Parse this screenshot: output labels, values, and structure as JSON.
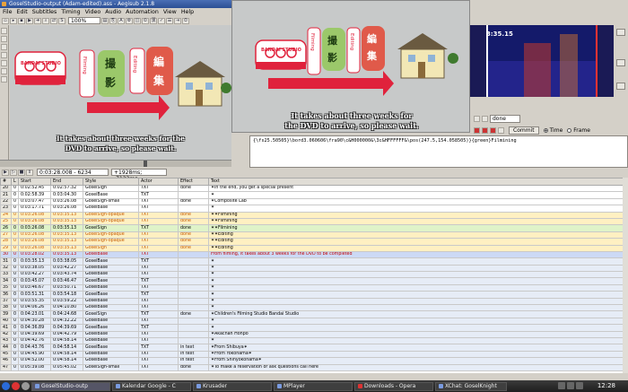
{
  "window_title": "GoselStudio-output (Adam-edited).ass - Aegisub 2.1.8",
  "menu": [
    "File",
    "Edit",
    "Subtitles",
    "Timing",
    "Video",
    "Audio",
    "Automation",
    "View",
    "Help"
  ],
  "zoom": "100%",
  "scene": {
    "studio_name": "BANDAI STUDIO",
    "film_label": "Filming",
    "film_kanji": [
      "撮",
      "影"
    ],
    "edit_label": "Editing",
    "edit_kanji": [
      "編",
      "集"
    ],
    "subtitle_line1": "It takes about three weeks for the",
    "subtitle_line2": "DVD to arrive, so please wait.",
    "subtitle_b_line1": "It takes about three weeks for",
    "subtitle_b_line2": "the DVD to arrive, so please wait.",
    "colors": {
      "bg": "#c7c9c9",
      "arrow": "#e0223c",
      "film_box": "#9bc86a",
      "edit_box": "#e05a4a",
      "house": "#f2e7b5",
      "roof": "#6a5a40"
    }
  },
  "video_time": "0:03:28.008 - 6234",
  "video_offset": "+1928ms; -7122ms",
  "audio_time": "3:35.15",
  "actor_value": "done",
  "commit_label": "Commit",
  "time_label": "Time",
  "frame_label": "Frame",
  "edit_text": "{\\fs25.50505}\\bord3.060606\\fra90\\c&H000000&\\3c&HFFFFFF&\\pos(247.5,154.058505)}{green}Filmining",
  "grid": {
    "headers": [
      "#",
      "L",
      "Start",
      "End",
      "Style",
      "Actor",
      "Effect",
      "Text"
    ],
    "rows": [
      {
        "n": "20",
        "l": "0",
        "s": "0:02:52.45",
        "e": "0:02:57.32",
        "st": "GoseiSign",
        "a": "TXT",
        "ef": "done",
        "t": "✶In the end, you get a special present",
        "c": "r-normal"
      },
      {
        "n": "21",
        "l": "0",
        "s": "0:02:58.39",
        "e": "0:03:04.30",
        "st": "GoseiBase",
        "a": "TXT",
        "ef": "",
        "t": "✶",
        "c": "r-normal"
      },
      {
        "n": "22",
        "l": "0",
        "s": "0:03:07.47",
        "e": "0:03:26.08",
        "st": "GoseiSign-small",
        "a": "TXT",
        "ef": "done",
        "t": "✶Composite Lab",
        "c": "r-normal"
      },
      {
        "n": "23",
        "l": "0",
        "s": "0:03:17.71",
        "e": "0:03:26.08",
        "st": "GoseiBase",
        "a": "TXT",
        "ef": "",
        "t": "✶",
        "c": "r-normal"
      },
      {
        "n": "24",
        "l": "0",
        "s": "0:03:26.08",
        "e": "0:03:35.13",
        "st": "GoseiSign-opaque",
        "a": "TXT",
        "ef": "done",
        "t": "✶✶Filmining",
        "c": "r-gold"
      },
      {
        "n": "25",
        "l": "0",
        "s": "0:03:26.08",
        "e": "0:03:35.13",
        "st": "GoseiSign-opaque",
        "a": "TXT",
        "ef": "done",
        "t": "✶✶Filmining",
        "c": "r-gold"
      },
      {
        "n": "26",
        "l": "0",
        "s": "0:03:26.08",
        "e": "0:03:35.13",
        "st": "GoseiSign",
        "a": "TXT",
        "ef": "done",
        "t": "✶✶Filmining",
        "c": "r-green"
      },
      {
        "n": "27",
        "l": "0",
        "s": "0:03:26.08",
        "e": "0:03:35.13",
        "st": "GoseiSign-opaque",
        "a": "TXT",
        "ef": "done",
        "t": "✶✶Editing",
        "c": "r-gold"
      },
      {
        "n": "28",
        "l": "0",
        "s": "0:03:26.08",
        "e": "0:03:35.13",
        "st": "GoseiSign-opaque",
        "a": "TXT",
        "ef": "done",
        "t": "✶✶Editing",
        "c": "r-gold"
      },
      {
        "n": "29",
        "l": "0",
        "s": "0:03:26.08",
        "e": "0:03:35.13",
        "st": "GoseiSign",
        "a": "TXT",
        "ef": "done",
        "t": "✶✶Editing",
        "c": "r-gold"
      },
      {
        "n": "30",
        "l": "0",
        "s": "0:03:28.02",
        "e": "0:03:35.13",
        "st": "GoseiBase",
        "a": "TXT",
        "ef": "",
        "t": "From filming, it takes about 3 weeks for the DVD to be completed",
        "c": "r-sel"
      },
      {
        "n": "31",
        "l": "0",
        "s": "0:03:35.13",
        "e": "0:03:38.05",
        "st": "GoseiBase",
        "a": "TXT",
        "ef": "",
        "t": "✶",
        "c": "r-alt"
      },
      {
        "n": "32",
        "l": "0",
        "s": "0:03:38.05",
        "e": "0:03:42.27",
        "st": "GoseiBase",
        "a": "TXT",
        "ef": "",
        "t": "✶",
        "c": "r-alt"
      },
      {
        "n": "33",
        "l": "0",
        "s": "0:03:42.27",
        "e": "0:03:43.74",
        "st": "GoseiBase",
        "a": "TXT",
        "ef": "",
        "t": "✶",
        "c": "r-alt"
      },
      {
        "n": "34",
        "l": "0",
        "s": "0:03:45.07",
        "e": "0:03:46.47",
        "st": "GoseiBase",
        "a": "TXT",
        "ef": "",
        "t": "✶",
        "c": "r-alt"
      },
      {
        "n": "35",
        "l": "0",
        "s": "0:03:46.67",
        "e": "0:03:50.71",
        "st": "GoseiBase",
        "a": "TXT",
        "ef": "",
        "t": "✶",
        "c": "r-alt"
      },
      {
        "n": "36",
        "l": "0",
        "s": "0:03:51.31",
        "e": "0:03:54.18",
        "st": "GoseiBase",
        "a": "TXT",
        "ef": "",
        "t": "✶",
        "c": "r-alt"
      },
      {
        "n": "37",
        "l": "0",
        "s": "0:03:55.35",
        "e": "0:03:59.22",
        "st": "GoseiBase",
        "a": "TXT",
        "ef": "",
        "t": "✶",
        "c": "r-alt"
      },
      {
        "n": "38",
        "l": "0",
        "s": "0:04:06.26",
        "e": "0:04:10.80",
        "st": "GoseiBase",
        "a": "TXT",
        "ef": "",
        "t": "✶",
        "c": "r-alt"
      },
      {
        "n": "39",
        "l": "0",
        "s": "0:04:23.01",
        "e": "0:04:24.68",
        "st": "GoseiSign",
        "a": "TXT",
        "ef": "done",
        "t": "✶Children's Filming Studio Bandai Studio",
        "c": "r-alt"
      },
      {
        "n": "40",
        "l": "0",
        "s": "0:04:30.28",
        "e": "0:04:32.22",
        "st": "GoseiBase",
        "a": "TXT",
        "ef": "",
        "t": "✶",
        "c": "r-alt"
      },
      {
        "n": "41",
        "l": "0",
        "s": "0:04:36.89",
        "e": "0:04:39.69",
        "st": "GoseiBase",
        "a": "TXT",
        "ef": "",
        "t": "✶",
        "c": "r-alt"
      },
      {
        "n": "42",
        "l": "0",
        "s": "0:04:39.69",
        "e": "0:04:42.79",
        "st": "GoseiBase",
        "a": "TXT",
        "ef": "",
        "t": "✶Akachan Honpo",
        "c": "r-alt"
      },
      {
        "n": "43",
        "l": "0",
        "s": "0:04:42.76",
        "e": "0:04:58.14",
        "st": "GoseiBase",
        "a": "TXT",
        "ef": "",
        "t": "✶",
        "c": "r-alt"
      },
      {
        "n": "44",
        "l": "0",
        "s": "0:04:43.76",
        "e": "0:04:58.14",
        "st": "GoseiBase",
        "a": "TXT",
        "ef": "in text",
        "t": "✶From Shibuya✶",
        "c": "r-alt"
      },
      {
        "n": "45",
        "l": "0",
        "s": "0:04:45.90",
        "e": "0:04:58.14",
        "st": "GoseiBase",
        "a": "TXT",
        "ef": "in text",
        "t": "✶From Yokohama✶",
        "c": "r-alt"
      },
      {
        "n": "46",
        "l": "0",
        "s": "0:04:52.00",
        "e": "0:04:58.14",
        "st": "GoseiBase",
        "a": "TXT",
        "ef": "in text",
        "t": "✶From Shinyokohama✶",
        "c": "r-alt"
      },
      {
        "n": "47",
        "l": "0",
        "s": "0:05:39.08",
        "e": "0:05:45.02",
        "st": "GoseiSign-small",
        "a": "TXT",
        "ef": "done",
        "t": "✶To make a reservation or ask questions call here",
        "c": "r-alt"
      }
    ]
  },
  "taskbar": {
    "items": [
      "GoselStudio-outp",
      "Kalendar Google - C",
      "Krusader",
      "MPlayer",
      "Downloads - Opera",
      "XChat: GoselKnight"
    ],
    "clock": "12:28"
  }
}
